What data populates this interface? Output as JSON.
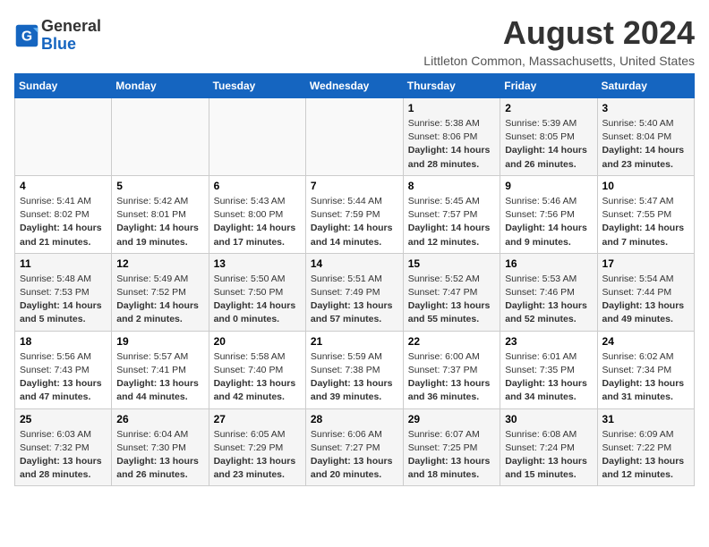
{
  "header": {
    "logo_general": "General",
    "logo_blue": "Blue",
    "month_year": "August 2024",
    "location": "Littleton Common, Massachusetts, United States"
  },
  "days_of_week": [
    "Sunday",
    "Monday",
    "Tuesday",
    "Wednesday",
    "Thursday",
    "Friday",
    "Saturday"
  ],
  "weeks": [
    [
      {
        "day": "",
        "info": ""
      },
      {
        "day": "",
        "info": ""
      },
      {
        "day": "",
        "info": ""
      },
      {
        "day": "",
        "info": ""
      },
      {
        "day": "1",
        "info": "Sunrise: 5:38 AM\nSunset: 8:06 PM\nDaylight: 14 hours and 28 minutes."
      },
      {
        "day": "2",
        "info": "Sunrise: 5:39 AM\nSunset: 8:05 PM\nDaylight: 14 hours and 26 minutes."
      },
      {
        "day": "3",
        "info": "Sunrise: 5:40 AM\nSunset: 8:04 PM\nDaylight: 14 hours and 23 minutes."
      }
    ],
    [
      {
        "day": "4",
        "info": "Sunrise: 5:41 AM\nSunset: 8:02 PM\nDaylight: 14 hours and 21 minutes."
      },
      {
        "day": "5",
        "info": "Sunrise: 5:42 AM\nSunset: 8:01 PM\nDaylight: 14 hours and 19 minutes."
      },
      {
        "day": "6",
        "info": "Sunrise: 5:43 AM\nSunset: 8:00 PM\nDaylight: 14 hours and 17 minutes."
      },
      {
        "day": "7",
        "info": "Sunrise: 5:44 AM\nSunset: 7:59 PM\nDaylight: 14 hours and 14 minutes."
      },
      {
        "day": "8",
        "info": "Sunrise: 5:45 AM\nSunset: 7:57 PM\nDaylight: 14 hours and 12 minutes."
      },
      {
        "day": "9",
        "info": "Sunrise: 5:46 AM\nSunset: 7:56 PM\nDaylight: 14 hours and 9 minutes."
      },
      {
        "day": "10",
        "info": "Sunrise: 5:47 AM\nSunset: 7:55 PM\nDaylight: 14 hours and 7 minutes."
      }
    ],
    [
      {
        "day": "11",
        "info": "Sunrise: 5:48 AM\nSunset: 7:53 PM\nDaylight: 14 hours and 5 minutes."
      },
      {
        "day": "12",
        "info": "Sunrise: 5:49 AM\nSunset: 7:52 PM\nDaylight: 14 hours and 2 minutes."
      },
      {
        "day": "13",
        "info": "Sunrise: 5:50 AM\nSunset: 7:50 PM\nDaylight: 14 hours and 0 minutes."
      },
      {
        "day": "14",
        "info": "Sunrise: 5:51 AM\nSunset: 7:49 PM\nDaylight: 13 hours and 57 minutes."
      },
      {
        "day": "15",
        "info": "Sunrise: 5:52 AM\nSunset: 7:47 PM\nDaylight: 13 hours and 55 minutes."
      },
      {
        "day": "16",
        "info": "Sunrise: 5:53 AM\nSunset: 7:46 PM\nDaylight: 13 hours and 52 minutes."
      },
      {
        "day": "17",
        "info": "Sunrise: 5:54 AM\nSunset: 7:44 PM\nDaylight: 13 hours and 49 minutes."
      }
    ],
    [
      {
        "day": "18",
        "info": "Sunrise: 5:56 AM\nSunset: 7:43 PM\nDaylight: 13 hours and 47 minutes."
      },
      {
        "day": "19",
        "info": "Sunrise: 5:57 AM\nSunset: 7:41 PM\nDaylight: 13 hours and 44 minutes."
      },
      {
        "day": "20",
        "info": "Sunrise: 5:58 AM\nSunset: 7:40 PM\nDaylight: 13 hours and 42 minutes."
      },
      {
        "day": "21",
        "info": "Sunrise: 5:59 AM\nSunset: 7:38 PM\nDaylight: 13 hours and 39 minutes."
      },
      {
        "day": "22",
        "info": "Sunrise: 6:00 AM\nSunset: 7:37 PM\nDaylight: 13 hours and 36 minutes."
      },
      {
        "day": "23",
        "info": "Sunrise: 6:01 AM\nSunset: 7:35 PM\nDaylight: 13 hours and 34 minutes."
      },
      {
        "day": "24",
        "info": "Sunrise: 6:02 AM\nSunset: 7:34 PM\nDaylight: 13 hours and 31 minutes."
      }
    ],
    [
      {
        "day": "25",
        "info": "Sunrise: 6:03 AM\nSunset: 7:32 PM\nDaylight: 13 hours and 28 minutes."
      },
      {
        "day": "26",
        "info": "Sunrise: 6:04 AM\nSunset: 7:30 PM\nDaylight: 13 hours and 26 minutes."
      },
      {
        "day": "27",
        "info": "Sunrise: 6:05 AM\nSunset: 7:29 PM\nDaylight: 13 hours and 23 minutes."
      },
      {
        "day": "28",
        "info": "Sunrise: 6:06 AM\nSunset: 7:27 PM\nDaylight: 13 hours and 20 minutes."
      },
      {
        "day": "29",
        "info": "Sunrise: 6:07 AM\nSunset: 7:25 PM\nDaylight: 13 hours and 18 minutes."
      },
      {
        "day": "30",
        "info": "Sunrise: 6:08 AM\nSunset: 7:24 PM\nDaylight: 13 hours and 15 minutes."
      },
      {
        "day": "31",
        "info": "Sunrise: 6:09 AM\nSunset: 7:22 PM\nDaylight: 13 hours and 12 minutes."
      }
    ]
  ]
}
